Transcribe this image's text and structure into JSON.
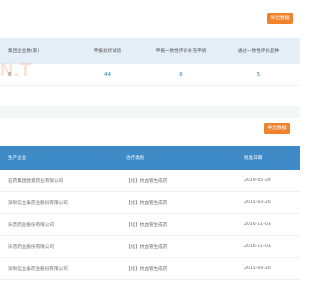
{
  "summary": {
    "export_label": "导出数据",
    "columns": [
      "集团企业数(家)",
      "申报总状试验",
      "申报一致性评价补充申请",
      "通过一致性评价品种"
    ],
    "row": [
      "6",
      "44",
      "6",
      "5"
    ]
  },
  "watermark": "N.T",
  "detail": {
    "export_label": "导出数据",
    "columns": [
      "生产企业",
      "治疗类别",
      "批准日期"
    ],
    "rows": [
      [
        "石药集团欧意药业有限公司",
        "【化】抗血管生成药",
        "2019-05-29"
      ],
      [
        "深圳信立泰药业股份有限公司",
        "【化】抗血管生成药",
        "2015-03-20"
      ],
      [
        "乐普药业股份有限公司",
        "【化】抗血管生成药",
        "2016-11-03"
      ],
      [
        "乐普药业股份有限公司",
        "【化】抗血管生成药",
        "2016-11-03"
      ],
      [
        "深圳信立泰药业股份有限公司",
        "【化】抗血管生成药",
        "2015-04-20"
      ]
    ]
  }
}
